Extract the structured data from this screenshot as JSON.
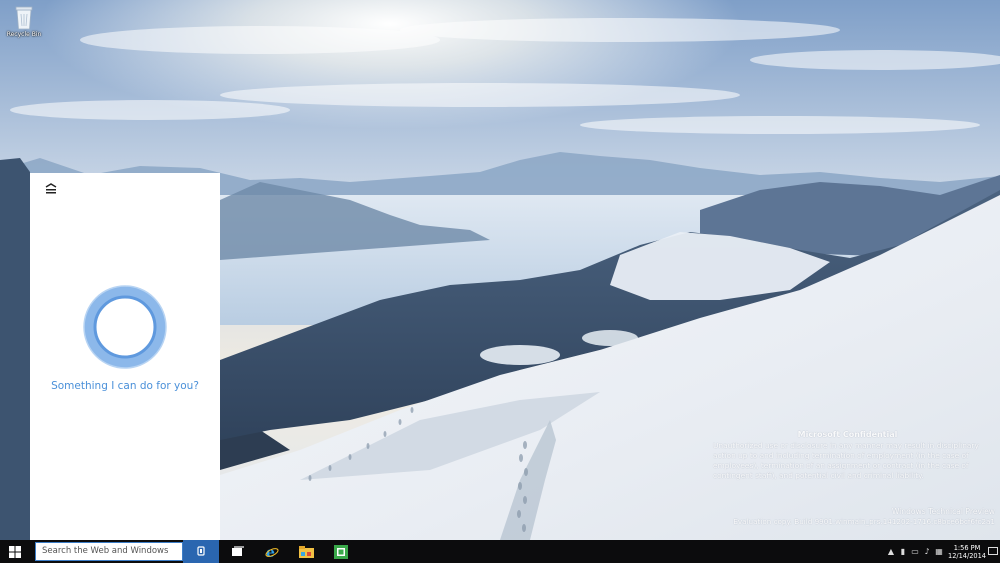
{
  "desktop": {
    "recycle_bin_label": "Recycle Bin",
    "icons": [
      "recycle-bin-icon"
    ]
  },
  "cortana": {
    "prompt": "Something I can do for you?",
    "accent_color": "#4a90d9",
    "icons": [
      "hamburger-menu-icon",
      "cortana-ring-icon"
    ]
  },
  "watermark": {
    "title": "Microsoft Confidential",
    "body": "Unauthorized use or disclosure in any manner may result in disciplinary action up to and including termination of employment (in the case of employees), termination of an assignment or contract (in the case of contingent staff), and potential civil and criminal liability.",
    "build": "Windows Technical Preview",
    "evaluation": "Evaluation copy. Build 9901.winmain_prs.141202-1716.c8bce6bcf6fc2a1"
  },
  "taskbar": {
    "search_placeholder": "Search the Web and Windows",
    "accent_color": "#2a66b0",
    "pinned": [
      "task-view-icon",
      "internet-explorer-icon",
      "file-explorer-icon",
      "store-icon"
    ],
    "tray_icons": [
      "chevron-up-icon",
      "network-icon",
      "battery-icon",
      "volume-icon",
      "keyboard-icon",
      "action-center-icon"
    ]
  },
  "clock": {
    "time": "1:56 PM",
    "date": "12/14/2014"
  }
}
